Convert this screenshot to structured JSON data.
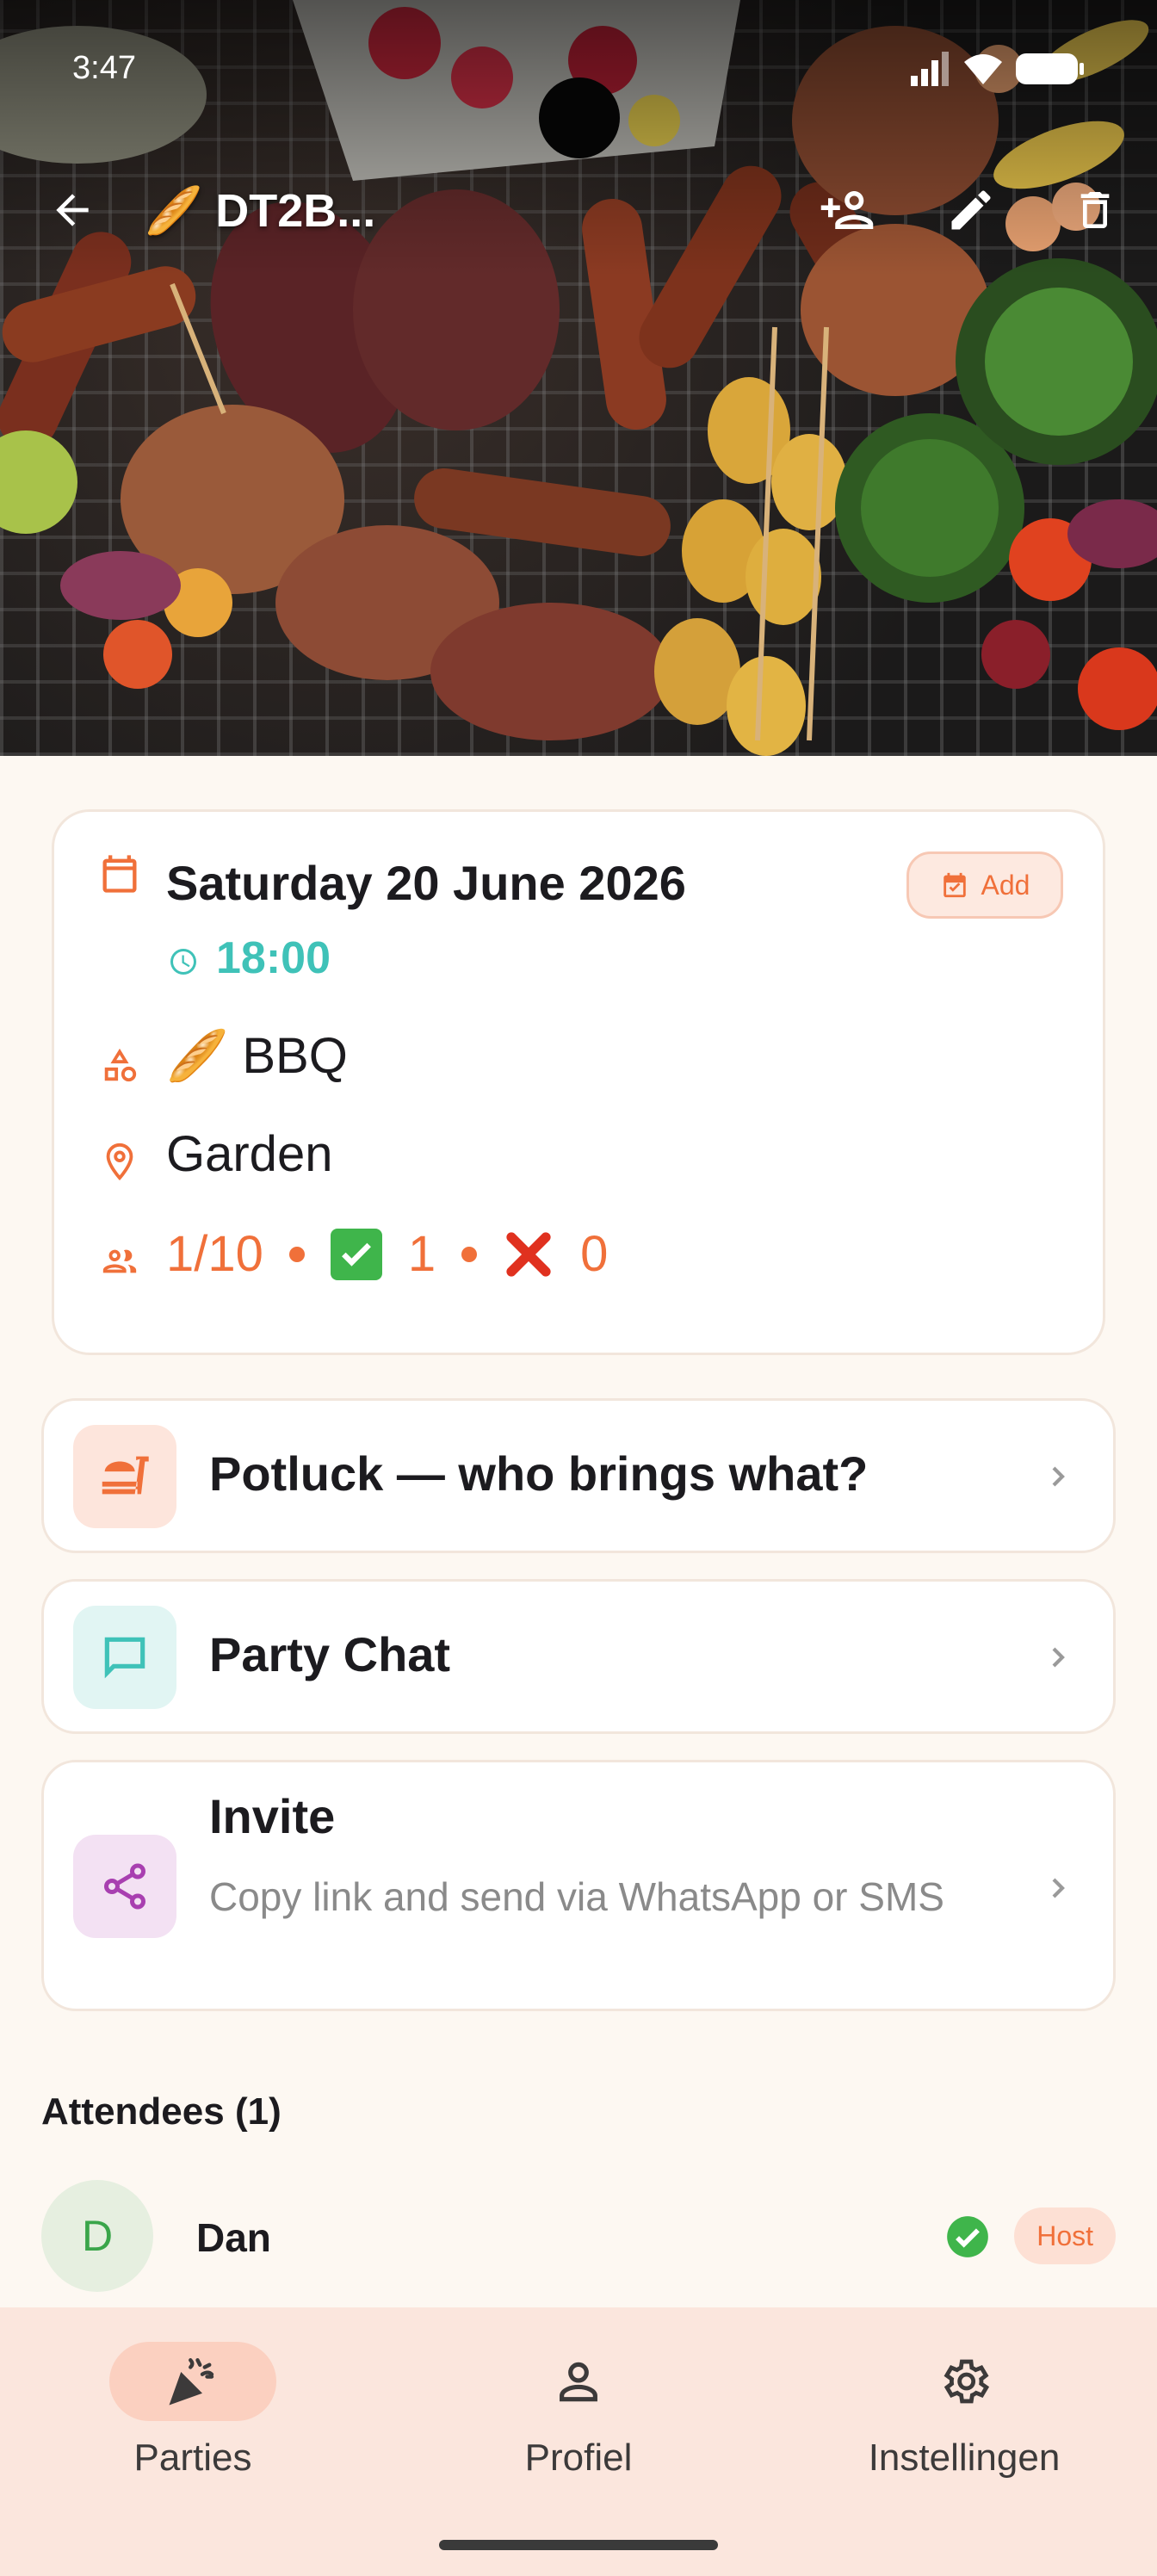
{
  "status_bar": {
    "time": "3:47"
  },
  "app_bar": {
    "title": "🥖 DT2B...",
    "icons": [
      "back-arrow-icon",
      "add-person-icon",
      "edit-pencil-icon",
      "trash-icon"
    ]
  },
  "event": {
    "date": "Saturday 20 June 2026",
    "time": "18:00",
    "type": "🥖 BBQ",
    "location": "Garden",
    "attending": "1/10",
    "accepted": "1",
    "declined": "0",
    "add_label": "Add"
  },
  "rows": {
    "potluck": {
      "title": "Potluck — who brings what?"
    },
    "chat": {
      "title": "Party Chat"
    },
    "invite": {
      "title": "Invite",
      "subtitle": "Copy link and send via WhatsApp or SMS"
    }
  },
  "attendees": {
    "heading": "Attendees (1)",
    "list": [
      {
        "initial": "D",
        "name": "Dan",
        "badge": "Host"
      }
    ]
  },
  "bottom_nav": {
    "items": [
      {
        "label": "Parties",
        "active": true
      },
      {
        "label": "Profiel",
        "active": false
      },
      {
        "label": "Instellingen",
        "active": false
      }
    ]
  },
  "colors": {
    "accent": "#f0703a",
    "teal": "#3fc2b8",
    "background": "#fdf8f2",
    "nav_background": "#fbe6dd"
  }
}
